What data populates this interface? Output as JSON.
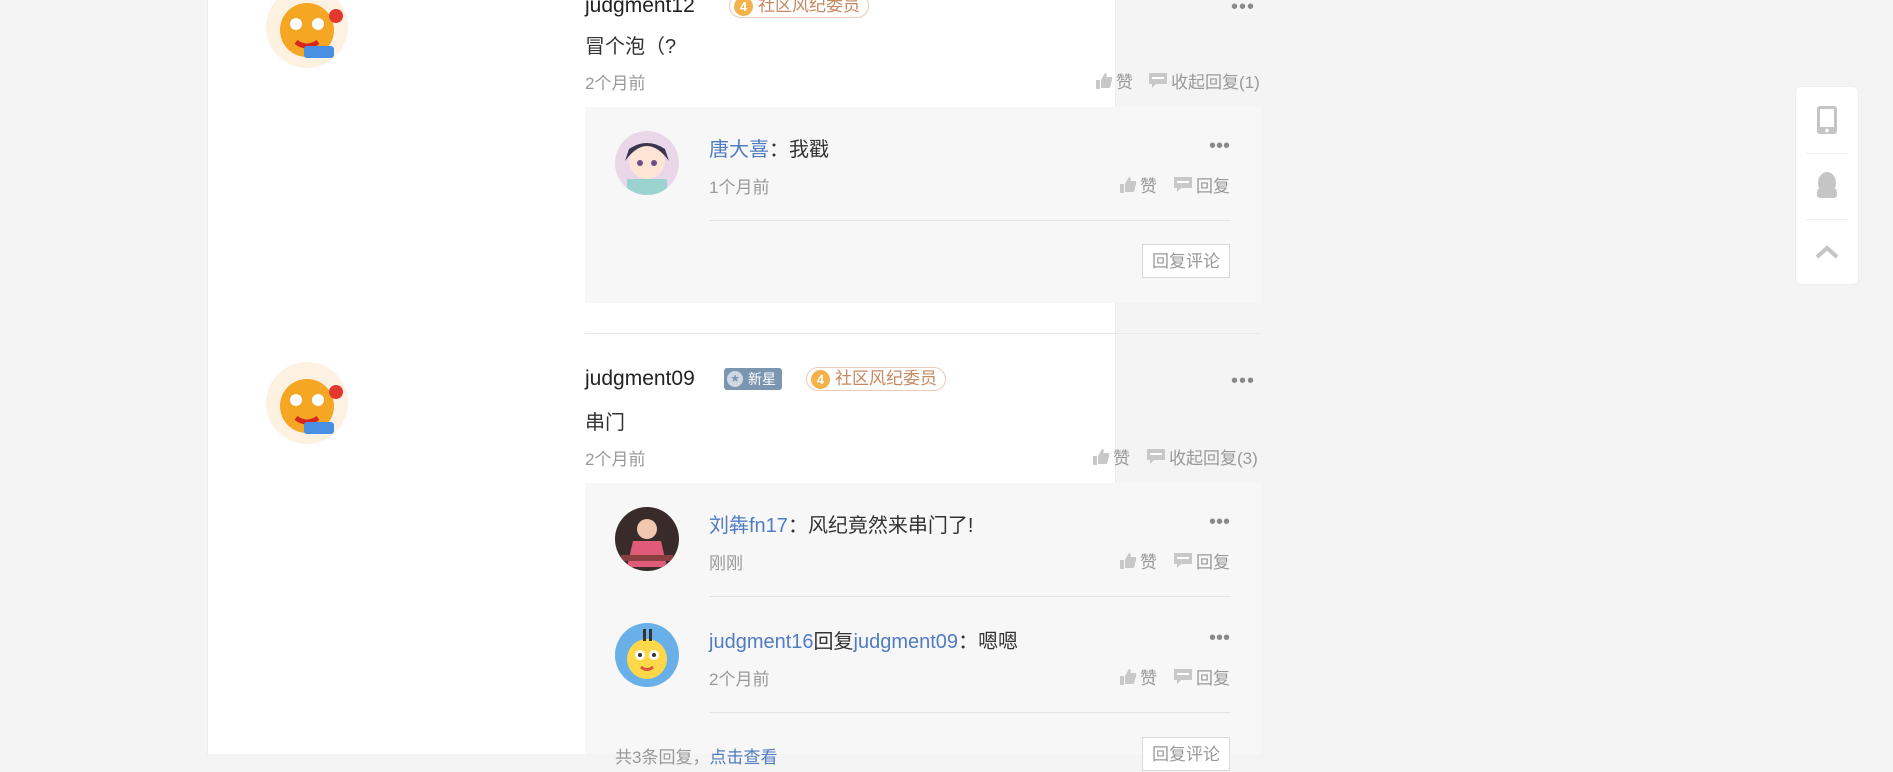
{
  "comments": [
    {
      "username": "judgment12",
      "level_num": "4",
      "level_title": "社区风纪委员",
      "text": "冒个泡（?",
      "time": "2个月前",
      "like_label": "赞",
      "toggle_label": "收起回复(1)",
      "replies": [
        {
          "user": "唐大喜",
          "colon": "：",
          "text": "我戳",
          "time": "1个月前",
          "like_label": "赞",
          "reply_label": "回复"
        }
      ],
      "reply_button": "回复评论"
    },
    {
      "username": "judgment09",
      "badge_new": "新星",
      "level_num": "4",
      "level_title": "社区风纪委员",
      "text": "串门",
      "time": "2个月前",
      "like_label": "赞",
      "toggle_label": "收起回复(3)",
      "replies": [
        {
          "user": "刘犇fn17",
          "colon": "：",
          "text": "风纪竟然来串门了!",
          "time": "刚刚",
          "like_label": "赞",
          "reply_label": "回复"
        },
        {
          "user": "judgment16",
          "mid": "回复",
          "target": "judgment09",
          "colon": "：",
          "text": "嗯嗯",
          "time": "2个月前",
          "like_label": "赞",
          "reply_label": "回复"
        }
      ],
      "footer_count": "共3条回复，",
      "footer_link": "点击查看",
      "reply_button": "回复评论"
    }
  ],
  "colors": {
    "link": "#4f7cc2",
    "level_badge": "#f5b24a",
    "new_badge": "#7c95b0"
  },
  "floatbar": {
    "icons": [
      "mobile-icon",
      "qq-penguin-icon",
      "back-to-top-icon"
    ]
  }
}
